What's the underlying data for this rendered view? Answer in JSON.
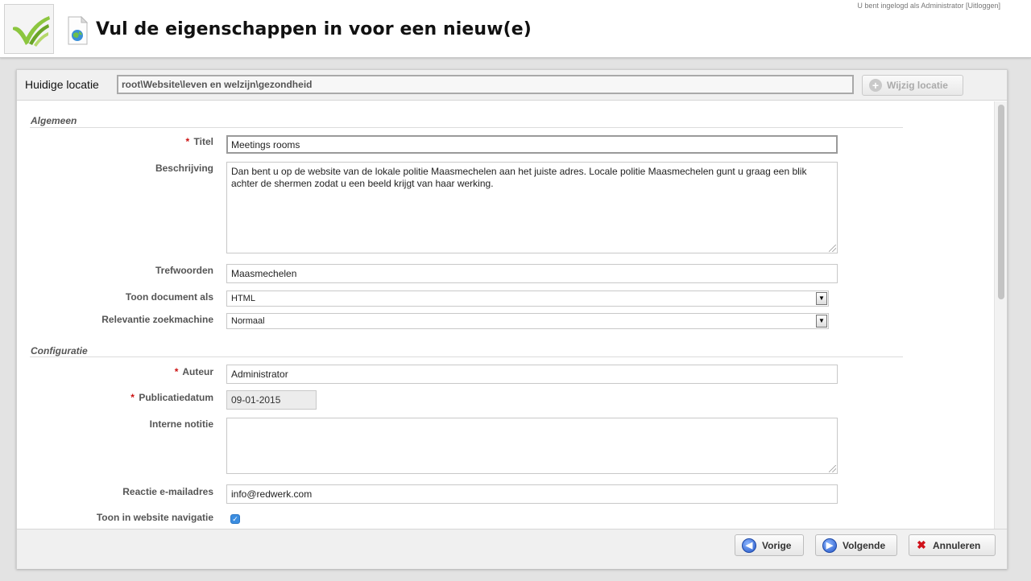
{
  "header": {
    "title": "Vul de eigenschappen in voor een nieuw(e)",
    "login_prefix": "U bent ingelogd als Administrator",
    "logout_label": "[Uitloggen]"
  },
  "location": {
    "label": "Huidige locatie",
    "path": "root\\Website\\leven en welzijn\\gezondheid",
    "change_button": "Wijzig locatie"
  },
  "sections": {
    "general": "Algemeen",
    "config": "Configuratie"
  },
  "form": {
    "required_mark": "*",
    "title_label": "Titel",
    "title_value": "Meetings rooms",
    "description_label": "Beschrijving",
    "description_value": "Dan bent u op de website van de lokale politie Maasmechelen aan het juiste adres. Locale politie Maasmechelen gunt u graag een blik achter de shermen zodat u een beeld krijgt van haar werking.",
    "keywords_label": "Trefwoorden",
    "keywords_value": "Maasmechelen",
    "show_as_label": "Toon document als",
    "show_as_value": "HTML",
    "relevance_label": "Relevantie zoekmachine",
    "relevance_value": "Normaal",
    "author_label": "Auteur",
    "author_value": "Administrator",
    "pubdate_label": "Publicatiedatum",
    "pubdate_value": "09-01-2015",
    "note_label": "Interne notitie",
    "note_value": "",
    "email_label": "Reactie e-mailadres",
    "email_value": "info@redwerk.com",
    "nav_label": "Toon in website navigatie",
    "nav_checked": true
  },
  "footer": {
    "prev_label": "Vorige",
    "next_label": "Volgende",
    "cancel_label": "Annuleren"
  },
  "icons": {
    "logo": "brand-logo-icon",
    "document": "document-globe-icon",
    "prev": "arrow-left-circle-icon",
    "next": "arrow-right-circle-icon",
    "cancel": "close-x-icon",
    "change_location": "plus-circle-icon",
    "dropdown": "dropdown-arrow-icon"
  },
  "colors": {
    "required": "#cc1111",
    "checkbox": "#3b8de0",
    "nav_button": "#2457c8",
    "cancel_x": "#d0121b"
  }
}
